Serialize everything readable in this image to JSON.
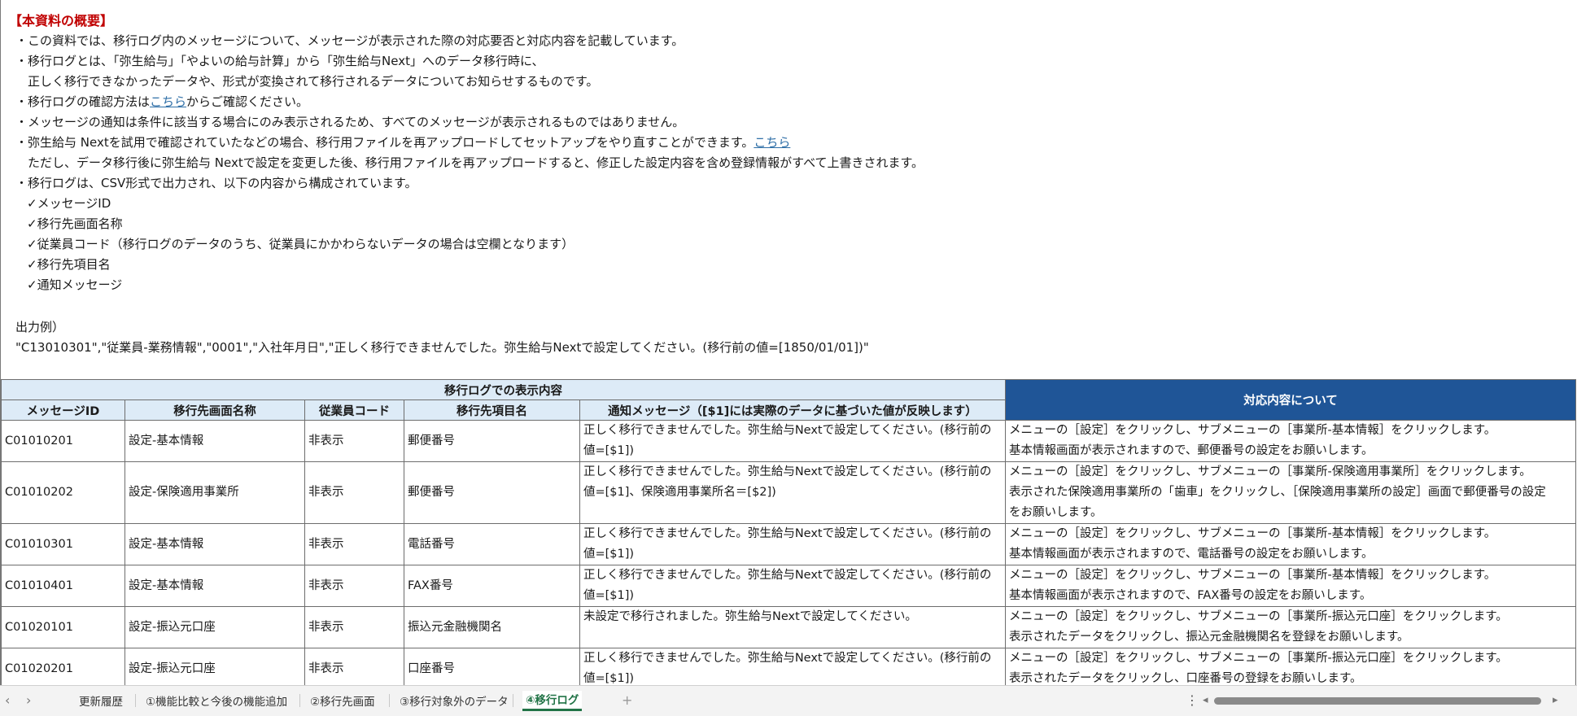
{
  "intro": {
    "title": "【本資料の概要】",
    "l1": "・この資料では、移行ログ内のメッセージについて、メッセージが表示された際の対応要否と対応内容を記載しています。",
    "l2": "・移行ログとは、「弥生給与」「やよいの給与計算」から「弥生給与Next」へのデータ移行時に、",
    "l3": "　正しく移行できなかったデータや、形式が変換されて移行されるデータについてお知らせするものです。",
    "l4a": "・移行ログの確認方法は",
    "l4link": "こちら",
    "l4b": "からご確認ください。",
    "l5": "・メッセージの通知は条件に該当する場合にのみ表示されるため、すべてのメッセージが表示されるものではありません。",
    "l6a": "・弥生給与 Nextを試用で確認されていたなどの場合、移行用ファイルを再アップロードしてセットアップをやり直すことができます。",
    "l6link": "こちら",
    "l7": "　ただし、データ移行後に弥生給与 Nextで設定を変更した後、移行用ファイルを再アップロードすると、修正した設定内容を含め登録情報がすべて上書きされます。",
    "l8": "・移行ログは、CSV形式で出力され、以下の内容から構成されています。",
    "c1": "✓メッセージID",
    "c2": "✓移行先画面名称",
    "c3": "✓従業員コード（移行ログのデータのうち、従業員にかかわらないデータの場合は空欄となります）",
    "c4": "✓移行先項目名",
    "c5": "✓通知メッセージ",
    "example_label": "出力例）",
    "example": "\"C13010301\",\"従業員-業務情報\",\"0001\",\"入社年月日\",\"正しく移行できませんでした。弥生給与Nextで設定してください。(移行前の値=[1850/01/01])\""
  },
  "table": {
    "group_header": "移行ログでの表示内容",
    "response_header": "対応内容について",
    "columns": [
      "メッセージID",
      "移行先画面名称",
      "従業員コード",
      "移行先項目名",
      "通知メッセージ（[$1]には実際のデータに基づいた値が反映します）"
    ],
    "rows": [
      {
        "id": "C01010201",
        "screen": "設定-基本情報",
        "emp": "非表示",
        "item": "郵便番号",
        "msg": "正しく移行できませんでした。弥生給与Nextで設定してください。(移行前の値=[$1])",
        "resp1": "メニューの［設定］をクリックし、サブメニューの［事業所-基本情報］をクリックします。",
        "resp2": "基本情報画面が表示されますので、郵便番号の設定をお願いします。",
        "resp3": ""
      },
      {
        "id": "C01010202",
        "screen": "設定-保険適用事業所",
        "emp": "非表示",
        "item": "郵便番号",
        "msg": "正しく移行できませんでした。弥生給与Nextで設定してください。(移行前の値=[$1]、保険適用事業所名＝[$2])",
        "resp1": "メニューの［設定］をクリックし、サブメニューの［事業所-保険適用事業所］をクリックします。",
        "resp2": "表示された保険適用事業所の「歯車」をクリックし、［保険適用事業所の設定］画面で郵便番号の設定",
        "resp3": "をお願いします。"
      },
      {
        "id": "C01010301",
        "screen": "設定-基本情報",
        "emp": "非表示",
        "item": "電話番号",
        "msg": "正しく移行できませんでした。弥生給与Nextで設定してください。(移行前の値=[$1])",
        "resp1": "メニューの［設定］をクリックし、サブメニューの［事業所-基本情報］をクリックします。",
        "resp2": "基本情報画面が表示されますので、電話番号の設定をお願いします。",
        "resp3": ""
      },
      {
        "id": "C01010401",
        "screen": "設定-基本情報",
        "emp": "非表示",
        "item": "FAX番号",
        "msg": "正しく移行できませんでした。弥生給与Nextで設定してください。(移行前の値=[$1])",
        "resp1": "メニューの［設定］をクリックし、サブメニューの［事業所-基本情報］をクリックします。",
        "resp2": "基本情報画面が表示されますので、FAX番号の設定をお願いします。",
        "resp3": ""
      },
      {
        "id": "C01020101",
        "screen": "設定-振込元口座",
        "emp": "非表示",
        "item": "振込元金融機関名",
        "msg": "未設定で移行されました。弥生給与Nextで設定してください。",
        "resp1": "メニューの［設定］をクリックし、サブメニューの［事業所-振込元口座］をクリックします。",
        "resp2": "表示されたデータをクリックし、振込元金融機関名を登録をお願いします。",
        "resp3": ""
      },
      {
        "id": "C01020201",
        "screen": "設定-振込元口座",
        "emp": "非表示",
        "item": "口座番号",
        "msg": "正しく移行できませんでした。弥生給与Nextで設定してください。(移行前の値=[$1])",
        "resp1": "メニューの［設定］をクリックし、サブメニューの［事業所-振込元口座］をクリックします。",
        "resp2": "表示されたデータをクリックし、口座番号の登録をお願いします。",
        "resp3": ""
      }
    ]
  },
  "tabs": [
    "更新履歴",
    "①機能比較と今後の機能追加",
    "②移行先画面",
    "③移行対象外のデータ",
    "④移行ログ"
  ],
  "tabbar": {
    "prev": "‹",
    "next": "›",
    "add": "+",
    "more": "⋮",
    "scroll_left": "◂",
    "scroll_right": "▸"
  },
  "colors": {
    "header_light": "#ddebf7",
    "header_dark": "#1f5597",
    "title_red": "#c00000",
    "active_tab": "#217346"
  }
}
